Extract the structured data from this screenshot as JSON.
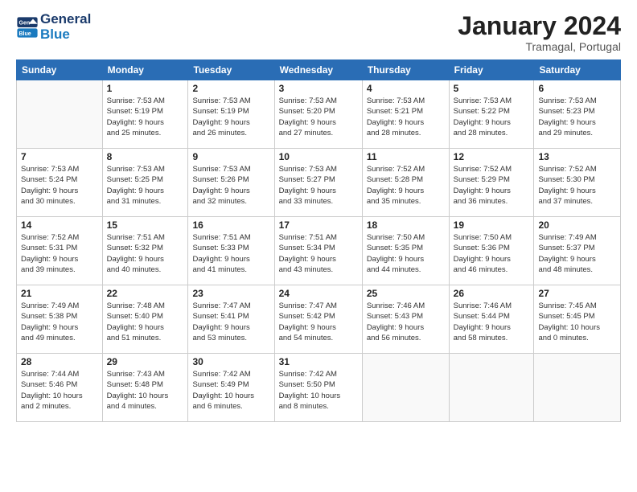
{
  "logo": {
    "line1": "General",
    "line2": "Blue"
  },
  "title": "January 2024",
  "location": "Tramagal, Portugal",
  "weekdays": [
    "Sunday",
    "Monday",
    "Tuesday",
    "Wednesday",
    "Thursday",
    "Friday",
    "Saturday"
  ],
  "weeks": [
    [
      {
        "day": "",
        "info": ""
      },
      {
        "day": "1",
        "info": "Sunrise: 7:53 AM\nSunset: 5:19 PM\nDaylight: 9 hours\nand 25 minutes."
      },
      {
        "day": "2",
        "info": "Sunrise: 7:53 AM\nSunset: 5:19 PM\nDaylight: 9 hours\nand 26 minutes."
      },
      {
        "day": "3",
        "info": "Sunrise: 7:53 AM\nSunset: 5:20 PM\nDaylight: 9 hours\nand 27 minutes."
      },
      {
        "day": "4",
        "info": "Sunrise: 7:53 AM\nSunset: 5:21 PM\nDaylight: 9 hours\nand 28 minutes."
      },
      {
        "day": "5",
        "info": "Sunrise: 7:53 AM\nSunset: 5:22 PM\nDaylight: 9 hours\nand 28 minutes."
      },
      {
        "day": "6",
        "info": "Sunrise: 7:53 AM\nSunset: 5:23 PM\nDaylight: 9 hours\nand 29 minutes."
      }
    ],
    [
      {
        "day": "7",
        "info": "Sunrise: 7:53 AM\nSunset: 5:24 PM\nDaylight: 9 hours\nand 30 minutes."
      },
      {
        "day": "8",
        "info": "Sunrise: 7:53 AM\nSunset: 5:25 PM\nDaylight: 9 hours\nand 31 minutes."
      },
      {
        "day": "9",
        "info": "Sunrise: 7:53 AM\nSunset: 5:26 PM\nDaylight: 9 hours\nand 32 minutes."
      },
      {
        "day": "10",
        "info": "Sunrise: 7:53 AM\nSunset: 5:27 PM\nDaylight: 9 hours\nand 33 minutes."
      },
      {
        "day": "11",
        "info": "Sunrise: 7:52 AM\nSunset: 5:28 PM\nDaylight: 9 hours\nand 35 minutes."
      },
      {
        "day": "12",
        "info": "Sunrise: 7:52 AM\nSunset: 5:29 PM\nDaylight: 9 hours\nand 36 minutes."
      },
      {
        "day": "13",
        "info": "Sunrise: 7:52 AM\nSunset: 5:30 PM\nDaylight: 9 hours\nand 37 minutes."
      }
    ],
    [
      {
        "day": "14",
        "info": "Sunrise: 7:52 AM\nSunset: 5:31 PM\nDaylight: 9 hours\nand 39 minutes."
      },
      {
        "day": "15",
        "info": "Sunrise: 7:51 AM\nSunset: 5:32 PM\nDaylight: 9 hours\nand 40 minutes."
      },
      {
        "day": "16",
        "info": "Sunrise: 7:51 AM\nSunset: 5:33 PM\nDaylight: 9 hours\nand 41 minutes."
      },
      {
        "day": "17",
        "info": "Sunrise: 7:51 AM\nSunset: 5:34 PM\nDaylight: 9 hours\nand 43 minutes."
      },
      {
        "day": "18",
        "info": "Sunrise: 7:50 AM\nSunset: 5:35 PM\nDaylight: 9 hours\nand 44 minutes."
      },
      {
        "day": "19",
        "info": "Sunrise: 7:50 AM\nSunset: 5:36 PM\nDaylight: 9 hours\nand 46 minutes."
      },
      {
        "day": "20",
        "info": "Sunrise: 7:49 AM\nSunset: 5:37 PM\nDaylight: 9 hours\nand 48 minutes."
      }
    ],
    [
      {
        "day": "21",
        "info": "Sunrise: 7:49 AM\nSunset: 5:38 PM\nDaylight: 9 hours\nand 49 minutes."
      },
      {
        "day": "22",
        "info": "Sunrise: 7:48 AM\nSunset: 5:40 PM\nDaylight: 9 hours\nand 51 minutes."
      },
      {
        "day": "23",
        "info": "Sunrise: 7:47 AM\nSunset: 5:41 PM\nDaylight: 9 hours\nand 53 minutes."
      },
      {
        "day": "24",
        "info": "Sunrise: 7:47 AM\nSunset: 5:42 PM\nDaylight: 9 hours\nand 54 minutes."
      },
      {
        "day": "25",
        "info": "Sunrise: 7:46 AM\nSunset: 5:43 PM\nDaylight: 9 hours\nand 56 minutes."
      },
      {
        "day": "26",
        "info": "Sunrise: 7:46 AM\nSunset: 5:44 PM\nDaylight: 9 hours\nand 58 minutes."
      },
      {
        "day": "27",
        "info": "Sunrise: 7:45 AM\nSunset: 5:45 PM\nDaylight: 10 hours\nand 0 minutes."
      }
    ],
    [
      {
        "day": "28",
        "info": "Sunrise: 7:44 AM\nSunset: 5:46 PM\nDaylight: 10 hours\nand 2 minutes."
      },
      {
        "day": "29",
        "info": "Sunrise: 7:43 AM\nSunset: 5:48 PM\nDaylight: 10 hours\nand 4 minutes."
      },
      {
        "day": "30",
        "info": "Sunrise: 7:42 AM\nSunset: 5:49 PM\nDaylight: 10 hours\nand 6 minutes."
      },
      {
        "day": "31",
        "info": "Sunrise: 7:42 AM\nSunset: 5:50 PM\nDaylight: 10 hours\nand 8 minutes."
      },
      {
        "day": "",
        "info": ""
      },
      {
        "day": "",
        "info": ""
      },
      {
        "day": "",
        "info": ""
      }
    ]
  ]
}
